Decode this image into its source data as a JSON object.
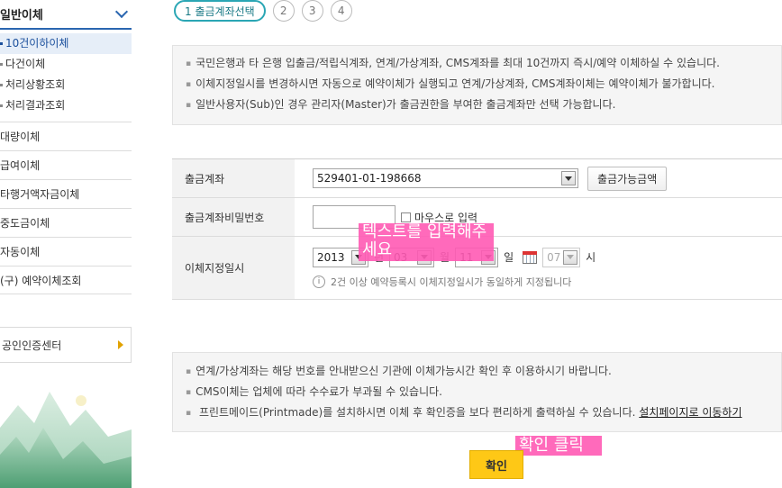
{
  "sidebar": {
    "title": "일반이체",
    "sub_items": [
      {
        "label": "10건이하이체",
        "active": true
      },
      {
        "label": "다건이체"
      },
      {
        "label": "처리상황조회"
      },
      {
        "label": "처리결과조회"
      }
    ],
    "menu_items": [
      {
        "label": "대량이체"
      },
      {
        "label": "급여이체"
      },
      {
        "label": "타행거액자금이체"
      },
      {
        "label": "중도금이체"
      },
      {
        "label": "자동이체"
      },
      {
        "label": "(구) 예약이체조회"
      }
    ],
    "cert_center": "공인인증센터"
  },
  "steps": [
    "1 출금계좌선택",
    "2",
    "3",
    "4"
  ],
  "info_top": [
    "국민은행과 타 은행 입출금/적립식계좌, 연계/가상계좌, CMS계좌를 최대 10건까지 즉시/예약 이체하실 수 있습니다.",
    "이체지정일시를 변경하시면 자동으로 예약이체가 실행되고 연계/가상계좌, CMS계좌이체는 예약이체가 불가합니다.",
    "일반사용자(Sub)인 경우 관리자(Master)가 출금권한을 부여한 출금계좌만 선택 가능합니다."
  ],
  "form": {
    "account_label": "출금계좌",
    "account_value": "529401-01-198668",
    "balance_button": "출금가능금액",
    "password_label": "출금계좌비밀번호",
    "mouse_input_label": "마우스로 입력",
    "date_label": "이체지정일시",
    "year": "2013",
    "year_unit": "년",
    "month": "03",
    "month_unit": "월",
    "day": "11",
    "day_unit": "일",
    "hour": "07",
    "hour_unit": "시",
    "note": "2건 이상 예약등록시 이체지정일시가 동일하게 지정됩니다"
  },
  "info_bottom": [
    "연계/가상계좌는 해당 번호를 안내받으신 기관에 이체가능시간 확인 후 이용하시기 바랍니다.",
    "CMS이체는 업체에 따라 수수료가 부과될 수 있습니다."
  ],
  "info_bottom_print": "프린트메이드(Printmade)를 설치하시면 이체 후 확인증을 보다 편리하게 출력하실 수 있습니다.",
  "info_bottom_link": "설치페이지로 이동하기",
  "overlay_text_input": "텍스트를 입력해주세요",
  "overlay_confirm": "확인 클릭",
  "confirm_button": "확인",
  "colors": {
    "accent": "#2a66b0",
    "step": "#2aa6b4",
    "confirm": "#fec816",
    "overlay": "#ff5ab4"
  }
}
